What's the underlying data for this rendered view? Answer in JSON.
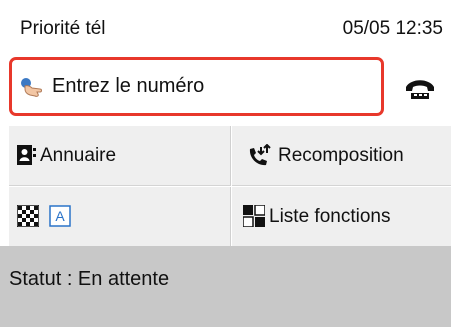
{
  "header": {
    "title": "Priorité tél",
    "datetime": "05/05 12:35"
  },
  "entry": {
    "label": "Entrez le numéro",
    "icon": "finger-pointing-icon",
    "border_color": "#e8382b"
  },
  "hook_button": {
    "icon": "phone-on-hook-icon"
  },
  "menu": {
    "directory": {
      "label": "Annuaire",
      "icon": "address-book-icon"
    },
    "redial": {
      "label": "Recomposition",
      "icon": "redial-phone-icon"
    },
    "quality": {
      "icons": [
        "resolution-checker-icon",
        "text-mode-icon"
      ],
      "mode_letter": "A"
    },
    "functions": {
      "label": "Liste fonctions",
      "icon": "function-list-icon"
    }
  },
  "status": {
    "text": "Statut : En attente"
  }
}
